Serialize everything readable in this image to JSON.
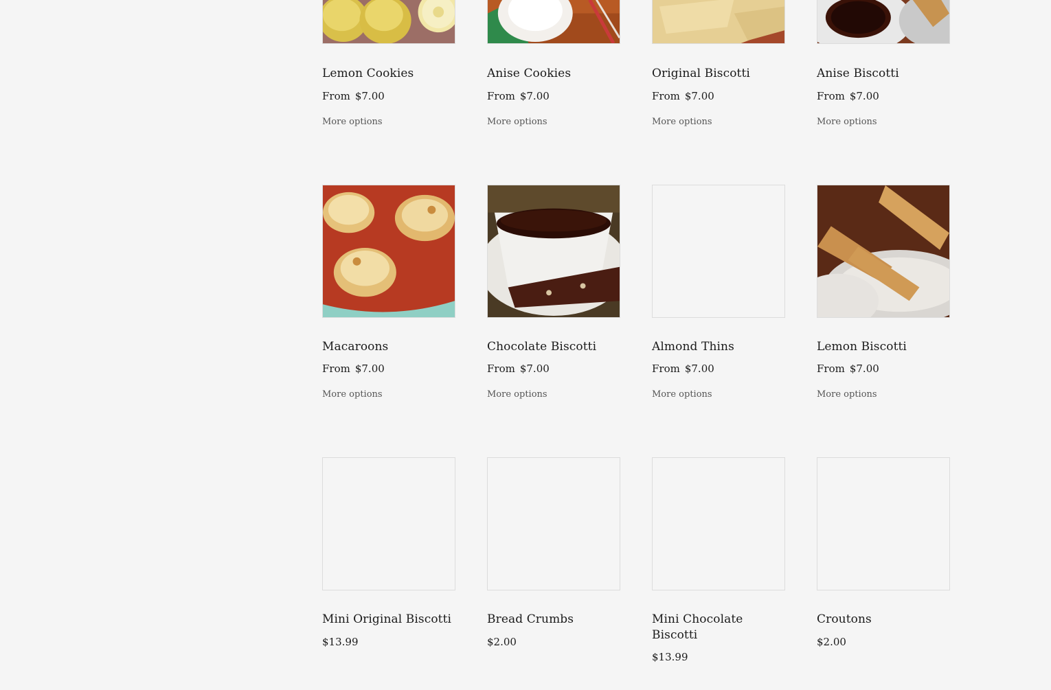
{
  "products": [
    {
      "name": "Lemon Cookies",
      "from_label": "From",
      "price": "$7.00",
      "more_options": "More options",
      "image": "lemon-cookies-photo"
    },
    {
      "name": "Anise Cookies",
      "from_label": "From",
      "price": "$7.00",
      "more_options": "More options",
      "image": "anise-cookies-photo"
    },
    {
      "name": "Original Biscotti",
      "from_label": "From",
      "price": "$7.00",
      "more_options": "More options",
      "image": "original-biscotti-photo"
    },
    {
      "name": "Anise Biscotti",
      "from_label": "From",
      "price": "$7.00",
      "more_options": "More options",
      "image": "anise-biscotti-photo"
    },
    {
      "name": "Macaroons",
      "from_label": "From",
      "price": "$7.00",
      "more_options": "More options",
      "image": "macaroons-photo"
    },
    {
      "name": "Chocolate Biscotti",
      "from_label": "From",
      "price": "$7.00",
      "more_options": "More options",
      "image": "chocolate-biscotti-photo"
    },
    {
      "name": "Almond Thins",
      "from_label": "From",
      "price": "$7.00",
      "more_options": "More options",
      "image": "empty-image-placeholder"
    },
    {
      "name": "Lemon Biscotti",
      "from_label": "From",
      "price": "$7.00",
      "more_options": "More options",
      "image": "lemon-biscotti-photo"
    },
    {
      "name": "Mini Original Biscotti",
      "price": "$13.99",
      "image": "empty-image-placeholder"
    },
    {
      "name": "Bread Crumbs",
      "price": "$2.00",
      "image": "empty-image-placeholder"
    },
    {
      "name": "Mini Chocolate Biscotti",
      "price": "$13.99",
      "image": "empty-image-placeholder"
    },
    {
      "name": "Croutons",
      "price": "$2.00",
      "image": "empty-image-placeholder"
    }
  ],
  "colors": {
    "background": "#f5f5f5",
    "text": "#1a1a1a",
    "muted": "#555555",
    "border": "#dcdcdc"
  }
}
